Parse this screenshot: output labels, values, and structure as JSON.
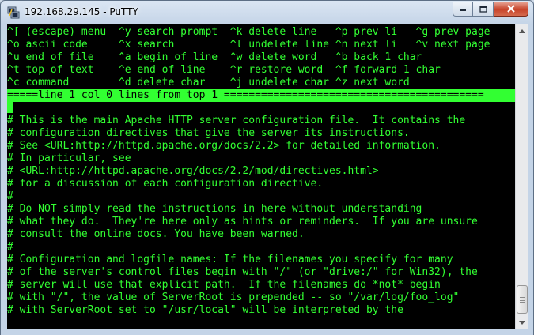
{
  "window": {
    "title": "192.168.29.145 - PuTTY",
    "icons": {
      "app": "putty-icon",
      "minimize": "minimize-icon",
      "maximize": "maximize-icon",
      "close": "close-icon"
    },
    "colors": {
      "terminal_bg": "#000000",
      "terminal_fg": "#32ff32"
    }
  },
  "terminal": {
    "lines": [
      "^[ (escape) menu  ^y search prompt  ^k delete line   ^p prev li   ^g prev page",
      "^o ascii code     ^x search         ^l undelete line ^n next li   ^v next page",
      "^u end of file    ^a begin of line  ^w delete word   ^b back 1 char",
      "^t top of text    ^e end of line    ^r restore word  ^f forward 1 char",
      "^c command        ^d delete char    ^j undelete char ^z next word",
      "=====line 1 col 0 lines from top 1 ==========================================",
      "#",
      "# This is the main Apache HTTP server configuration file.  It contains the",
      "# configuration directives that give the server its instructions.",
      "# See <URL:http://httpd.apache.org/docs/2.2> for detailed information.",
      "# In particular, see",
      "# <URL:http://httpd.apache.org/docs/2.2/mod/directives.html>",
      "# for a discussion of each configuration directive.",
      "#",
      "# Do NOT simply read the instructions in here without understanding",
      "# what they do.  They're here only as hints or reminders.  If you are unsure",
      "# consult the online docs. You have been warned.",
      "#",
      "# Configuration and logfile names: If the filenames you specify for many",
      "# of the server's control files begin with \"/\" (or \"drive:/\" for Win32), the",
      "# server will use that explicit path.  If the filenames do *not* begin",
      "# with \"/\", the value of ServerRoot is prepended -- so \"/var/log/foo_log\"",
      "# with ServerRoot set to \"/usr/local\" will be interpreted by the"
    ],
    "status_line_index": 5
  }
}
